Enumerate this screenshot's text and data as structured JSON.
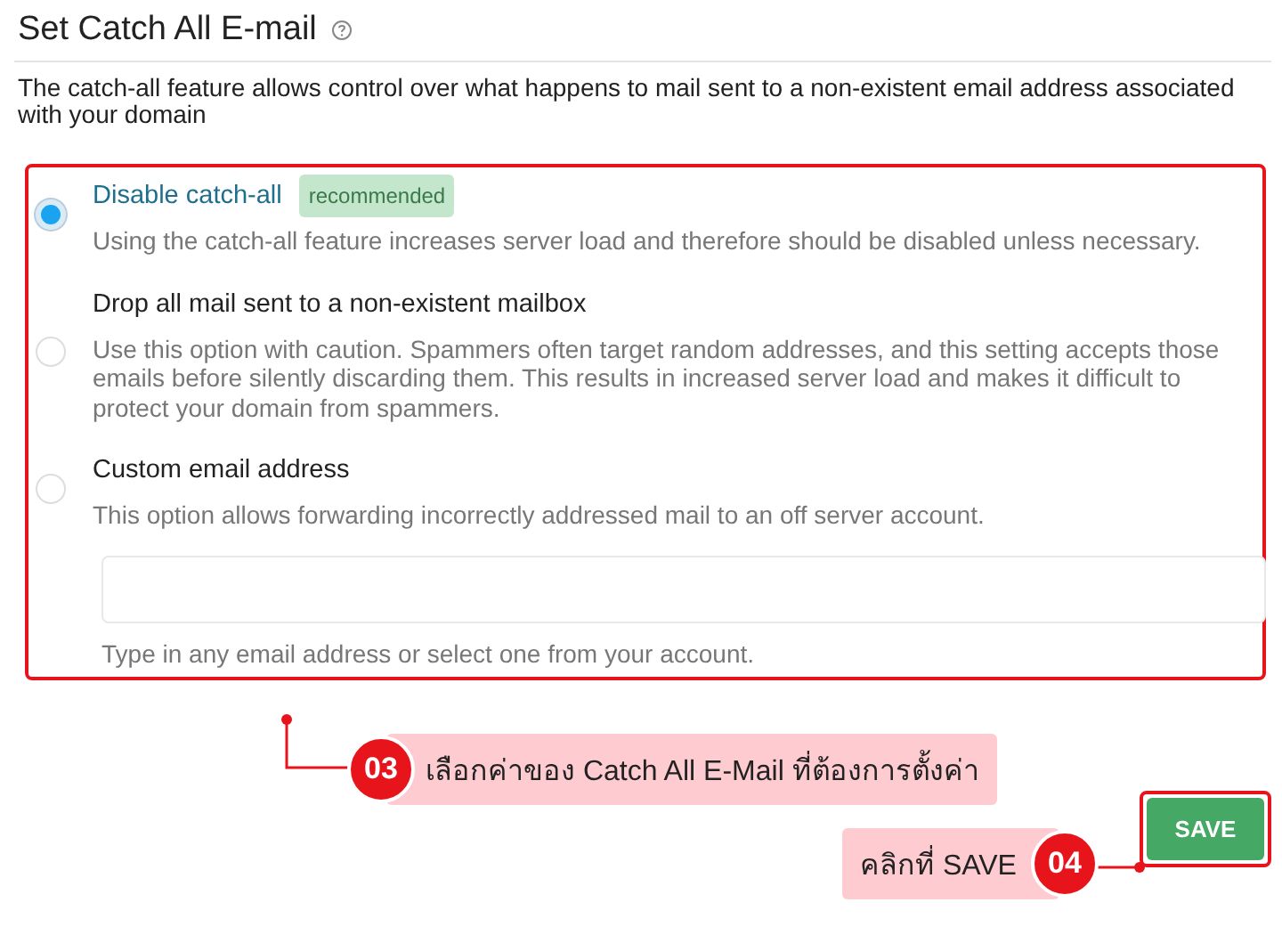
{
  "header": {
    "title": "Set Catch All E-mail",
    "description": "The catch-all feature allows control over what happens to mail sent to a non-existent email address associated with your domain"
  },
  "options": [
    {
      "label": "Disable catch-all",
      "badge": "recommended",
      "description": "Using the catch-all feature increases server load and therefore should be disabled unless necessary.",
      "selected": true
    },
    {
      "label": "Drop all mail sent to a non-existent mailbox",
      "description": "Use this option with caution. Spammers often target random addresses, and this setting accepts those emails before silently discarding them. This results in increased server load and makes it difficult to protect your domain from spammers.",
      "selected": false
    },
    {
      "label": "Custom email address",
      "description": "This option allows forwarding incorrectly addressed mail to an off server account.",
      "selected": false
    }
  ],
  "custom_email": {
    "helper": "Type in any email address or select one from your account."
  },
  "annotations": [
    {
      "number": "03",
      "text": "เลือกค่าของ Catch All E-Mail ที่ต้องการตั้งค่า"
    },
    {
      "number": "04",
      "text": "คลิกที่ SAVE"
    }
  ],
  "save_button": "SAVE"
}
